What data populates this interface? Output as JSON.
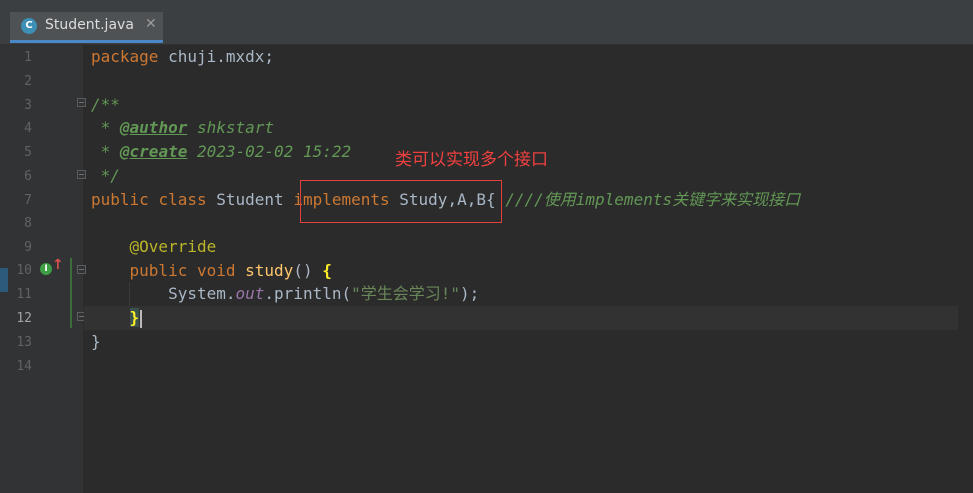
{
  "tab": {
    "icon_letter": "C",
    "title": "Student.java",
    "close": "✕"
  },
  "gutter": {
    "line_numbers": [
      "1",
      "2",
      "3",
      "4",
      "5",
      "6",
      "7",
      "8",
      "9",
      "10",
      "11",
      "12",
      "13",
      "14"
    ],
    "override_marker": "I",
    "override_arrow": "↑"
  },
  "code": {
    "l1_kw": "package",
    "l1_rest": " chuji.mxdx;",
    "l3": "/**",
    "l4_prefix": " * ",
    "l4_tag": "@author",
    "l4_value": " shkstart",
    "l5_prefix": " * ",
    "l5_tag": "@create",
    "l5_value": " 2023-02-02 15:22",
    "l6": " */",
    "l7_kw1": "public",
    "l7_sp1": " ",
    "l7_kw2": "class",
    "l7_name": " Student ",
    "l7_kw3": "implements",
    "l7_ifaces": " Study,A,B",
    "l7_brace": "{ ",
    "l7_comment": "////使用implements关键字来实现接口",
    "l9_ann": "@Override",
    "l10_kw1": "public",
    "l10_sp": " ",
    "l10_kw2": "void",
    "l10_sp2": " ",
    "l10_fn": "study",
    "l10_paren": "() ",
    "l10_brace": "{",
    "l11_obj": "System.",
    "l11_field": "out",
    "l11_call": ".println(",
    "l11_str": "\"学生会学习!\"",
    "l11_end": ");",
    "l12_brace": "}",
    "l13": "}"
  },
  "annotation": {
    "note": "类可以实现多个接口"
  },
  "colors": {
    "background": "#2b2b2b",
    "keyword": "#cc7832",
    "comment": "#629755",
    "annotation": "#bbb529",
    "string": "#6a8759",
    "method": "#ffc66d",
    "highlight_box": "#e0413d"
  }
}
